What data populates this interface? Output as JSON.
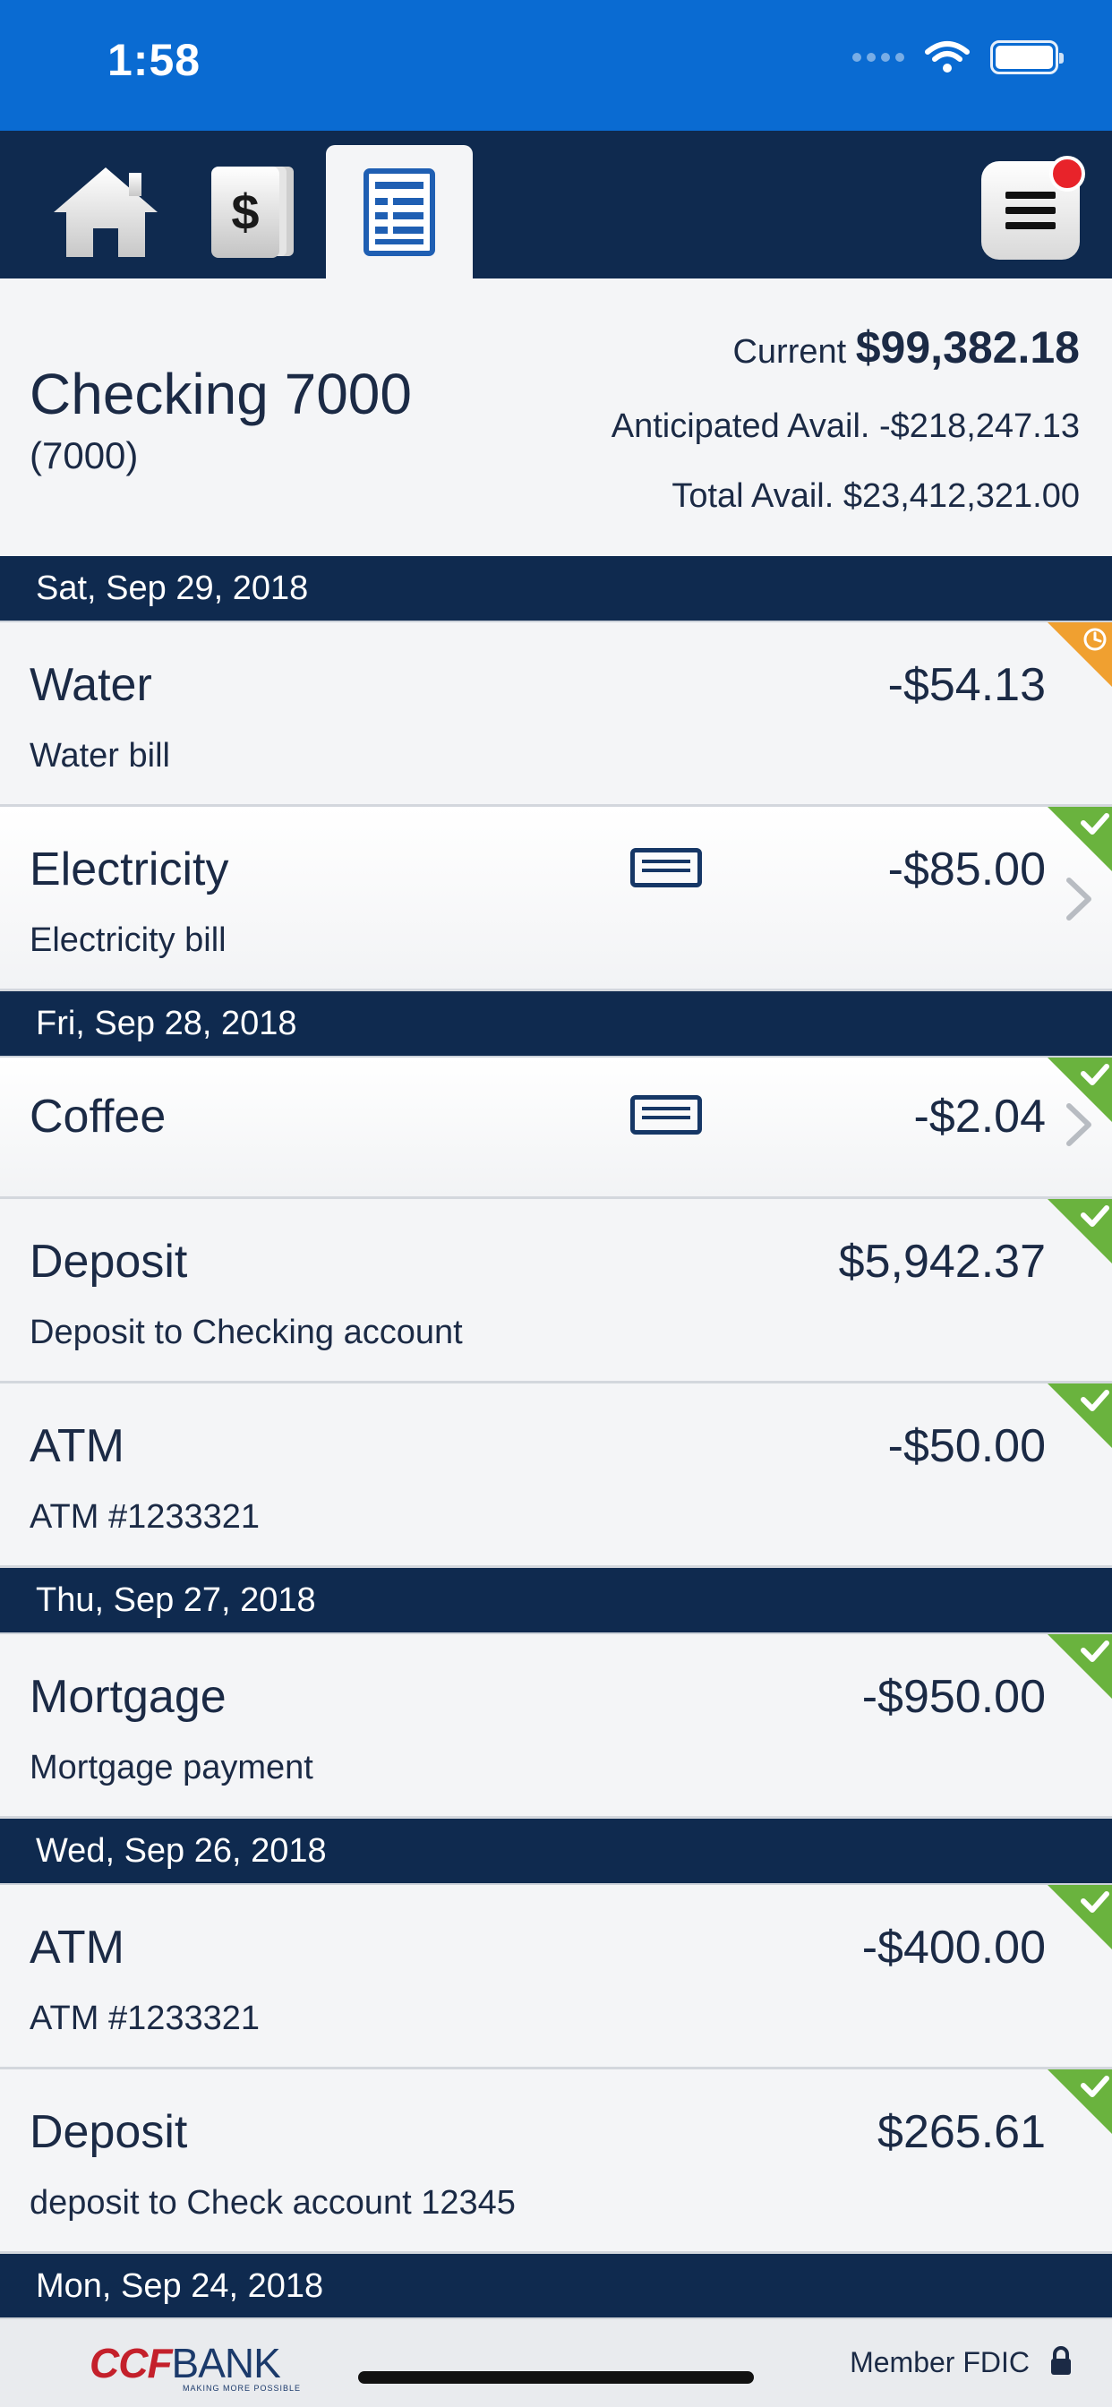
{
  "status_bar": {
    "time": "1:58"
  },
  "nav": {
    "tabs": [
      {
        "name": "home",
        "icon": "home-icon"
      },
      {
        "name": "accounts",
        "icon": "dollar-cards-icon"
      },
      {
        "name": "transactions",
        "icon": "ledger-icon",
        "active": true
      }
    ],
    "menu_icon": "hamburger-menu-icon"
  },
  "account": {
    "name": "Checking 7000",
    "number": "(7000)",
    "current_label": "Current",
    "current_amount": "$99,382.18",
    "anticipated_label": "Anticipated Avail.",
    "anticipated_amount": "-$218,247.13",
    "total_label": "Total Avail.",
    "total_amount": "$23,412,321.00"
  },
  "groups": [
    {
      "date": "Sat, Sep 29, 2018",
      "transactions": [
        {
          "name": "Water",
          "description": "Water bill",
          "amount": "-$54.13",
          "status": "pending",
          "card": false,
          "chevron": false
        },
        {
          "name": "Electricity",
          "description": "Electricity bill",
          "amount": "-$85.00",
          "status": "cleared",
          "card": true,
          "chevron": true
        }
      ]
    },
    {
      "date": "Fri, Sep 28, 2018",
      "transactions": [
        {
          "name": "Coffee",
          "description": "",
          "amount": "-$2.04",
          "status": "cleared",
          "card": true,
          "chevron": true
        },
        {
          "name": "Deposit",
          "description": "Deposit to Checking account",
          "amount": "$5,942.37",
          "status": "cleared",
          "card": false,
          "chevron": false
        },
        {
          "name": "ATM",
          "description": "ATM #1233321",
          "amount": "-$50.00",
          "status": "cleared",
          "card": false,
          "chevron": false
        }
      ]
    },
    {
      "date": "Thu, Sep 27, 2018",
      "transactions": [
        {
          "name": "Mortgage",
          "description": "Mortgage payment",
          "amount": "-$950.00",
          "status": "cleared",
          "card": false,
          "chevron": false
        }
      ]
    },
    {
      "date": "Wed, Sep 26, 2018",
      "transactions": [
        {
          "name": "ATM",
          "description": "ATM #1233321",
          "amount": "-$400.00",
          "status": "cleared",
          "card": false,
          "chevron": false
        },
        {
          "name": "Deposit",
          "description": "deposit to Check account 12345",
          "amount": "$265.61",
          "status": "cleared",
          "card": false,
          "chevron": false
        }
      ]
    },
    {
      "date": "Mon, Sep 24, 2018",
      "transactions": []
    }
  ],
  "footer": {
    "logo_ccf": "CCF",
    "logo_bank": "BANK",
    "logo_tagline": "MAKING MORE POSSIBLE",
    "fdic": "Member FDIC"
  },
  "colors": {
    "status_bar": "#0a6bd2",
    "nav": "#0f2a4f",
    "text": "#1b2a45",
    "cleared": "#6ab33e",
    "pending": "#f0a030",
    "badge": "#e8232a"
  }
}
